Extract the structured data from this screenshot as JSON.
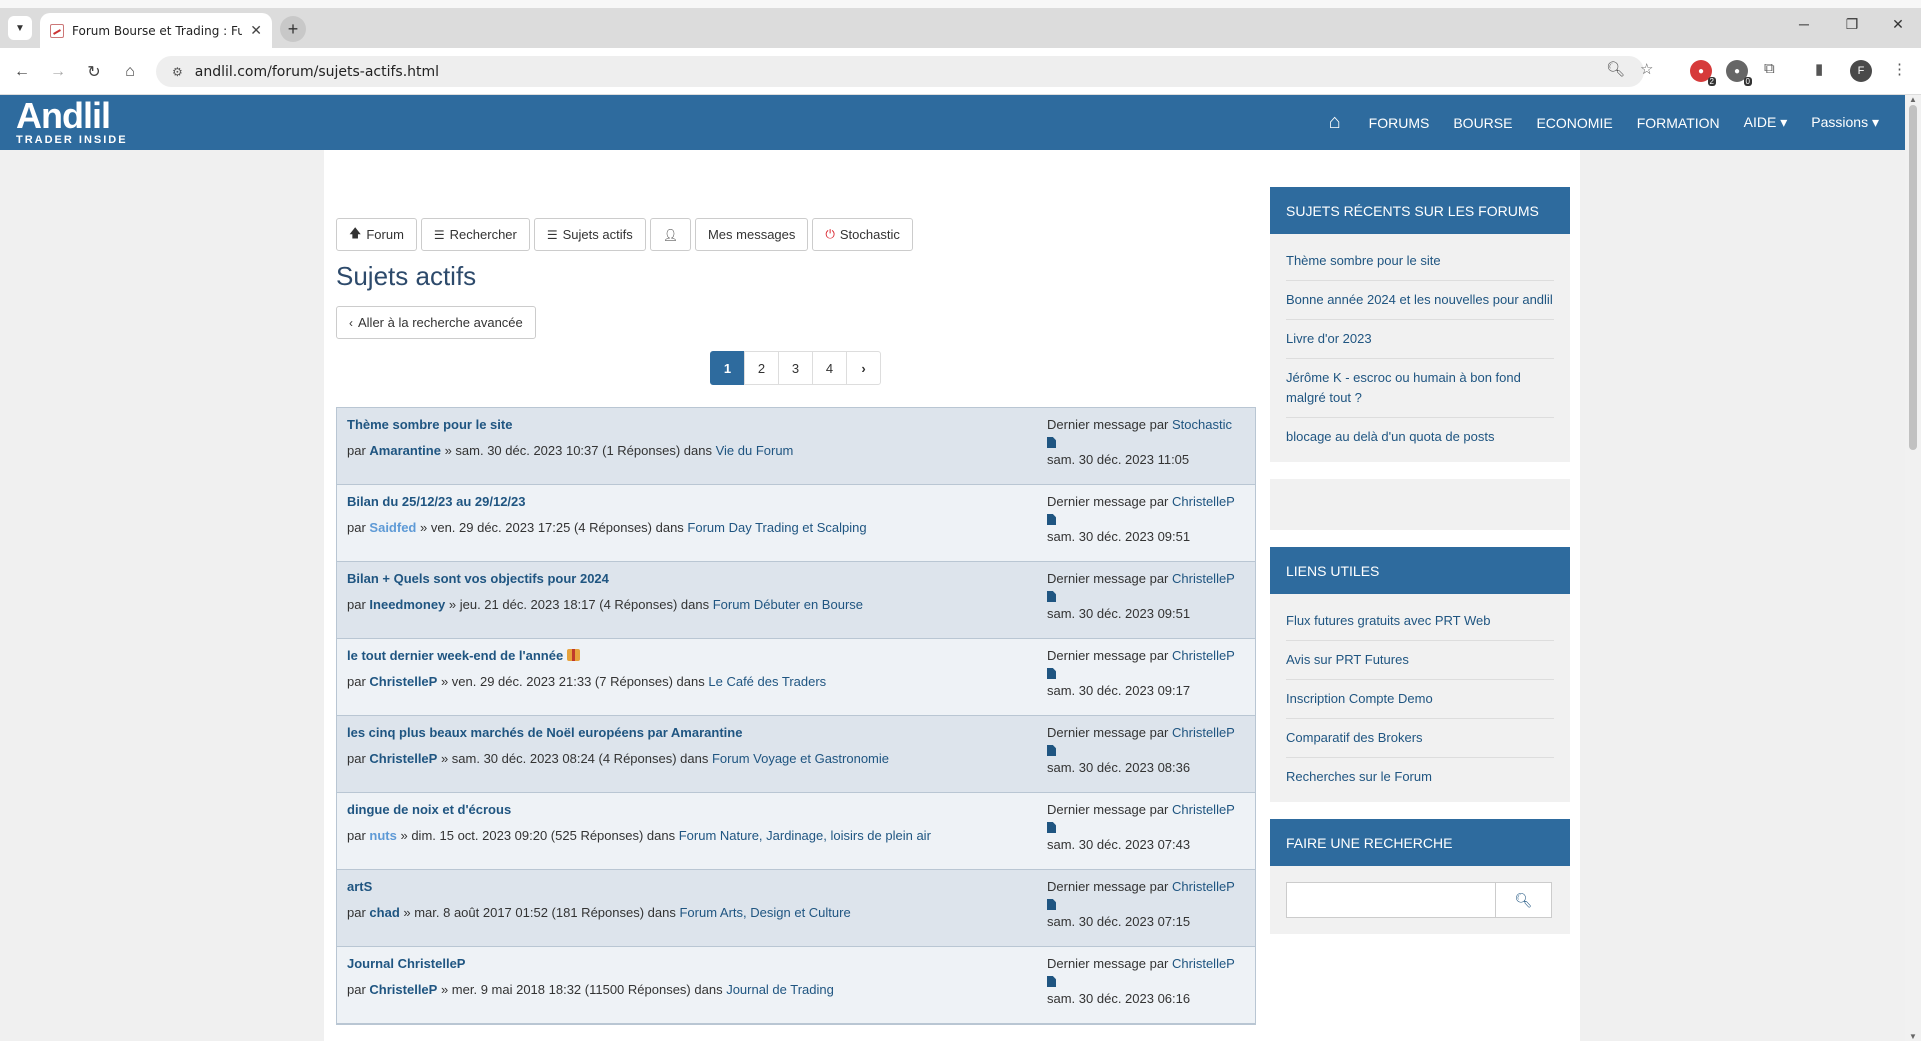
{
  "browser": {
    "tab_title": "Forum Bourse et Trading : Futures",
    "url": "andlil.com/forum/sujets-actifs.html",
    "new_tab_symbol": "+",
    "ext_badge_1": "2",
    "ext_badge_2": "0",
    "profile_initial": "F"
  },
  "site": {
    "logo_main": "Andlil",
    "logo_sub": "TRADER INSIDE",
    "nav": [
      "FORUMS",
      "BOURSE",
      "ECONOMIE",
      "FORMATION",
      "AIDE ▾",
      "Passions ▾"
    ]
  },
  "toolbar": {
    "forum": "Forum",
    "search": "Rechercher",
    "active": "Sujets actifs",
    "messages": "Mes messages",
    "logout": "Stochastic"
  },
  "page_title": "Sujets actifs",
  "advanced_search": "Aller à la recherche avancée",
  "pagination": [
    "1",
    "2",
    "3",
    "4"
  ],
  "topics": [
    {
      "title": "Thème sombre pour le site",
      "by": "par",
      "author": "Amarantine",
      "meta": " » sam. 30 déc. 2023 10:37 (1 Réponses) dans ",
      "forum": "Vie du Forum",
      "last_label": "Dernier message par ",
      "last_user": "Stochastic",
      "last_date": "sam. 30 déc. 2023 11:05"
    },
    {
      "title": "Bilan du 25/12/23 au 29/12/23",
      "by": "par",
      "author": "Saidfed",
      "meta": " » ven. 29 déc. 2023 17:25 (4 Réponses) dans ",
      "forum": "Forum Day Trading et Scalping",
      "last_label": "Dernier message par ",
      "last_user": "ChristelleP",
      "last_date": "sam. 30 déc. 2023 09:51"
    },
    {
      "title": "Bilan + Quels sont vos objectifs pour 2024",
      "by": "par",
      "author": "Ineedmoney",
      "meta": " » jeu. 21 déc. 2023 18:17 (4 Réponses) dans ",
      "forum": "Forum Débuter en Bourse",
      "last_label": "Dernier message par ",
      "last_user": "ChristelleP",
      "last_date": "sam. 30 déc. 2023 09:51"
    },
    {
      "title": "le tout dernier week-end de l'année",
      "by": "par",
      "author": "ChristelleP",
      "meta": " » ven. 29 déc. 2023 21:33 (7 Réponses) dans ",
      "forum": "Le Café des Traders",
      "last_label": "Dernier message par ",
      "last_user": "ChristelleP",
      "last_date": "sam. 30 déc. 2023 09:17"
    },
    {
      "title": "les cinq plus beaux marchés de Noël européens par Amarantine",
      "by": "par",
      "author": "ChristelleP",
      "meta": " » sam. 30 déc. 2023 08:24 (4 Réponses) dans ",
      "forum": "Forum Voyage et Gastronomie",
      "last_label": "Dernier message par ",
      "last_user": "ChristelleP",
      "last_date": "sam. 30 déc. 2023 08:36"
    },
    {
      "title": "dingue de noix et d'écrous",
      "by": "par",
      "author": "nuts",
      "meta": " » dim. 15 oct. 2023 09:20 (525 Réponses) dans ",
      "forum": "Forum Nature, Jardinage, loisirs de plein air",
      "last_label": "Dernier message par ",
      "last_user": "ChristelleP",
      "last_date": "sam. 30 déc. 2023 07:43"
    },
    {
      "title": "artS",
      "by": "par",
      "author": "chad",
      "meta": " » mar. 8 août 2017 01:52 (181 Réponses) dans ",
      "forum": "Forum Arts, Design et Culture",
      "last_label": "Dernier message par ",
      "last_user": "ChristelleP",
      "last_date": "sam. 30 déc. 2023 07:15"
    },
    {
      "title": "Journal ChristelleP",
      "by": "par",
      "author": "ChristelleP",
      "meta": " » mer. 9 mai 2018 18:32 (11500 Réponses) dans ",
      "forum": "Journal de Trading",
      "last_label": "Dernier message par ",
      "last_user": "ChristelleP",
      "last_date": "sam. 30 déc. 2023 06:16"
    }
  ],
  "sidebar": {
    "recent_title": "SUJETS RÉCENTS SUR LES FORUMS",
    "recent": [
      "Thème sombre pour le site",
      "Bonne année 2024 et les nouvelles pour andlil",
      "Livre d'or 2023",
      "Jérôme K - escroc ou humain à bon fond malgré tout ?",
      "blocage au delà d'un quota de posts"
    ],
    "links_title": "LIENS UTILES",
    "links": [
      "Flux futures gratuits avec PRT Web",
      "Avis sur PRT Futures",
      "Inscription Compte Demo",
      "Comparatif des Brokers",
      "Recherches sur le Forum"
    ],
    "search_title": "FAIRE UNE RECHERCHE"
  },
  "colors": {
    "brand": "#2e6b9e",
    "link": "#1f5581",
    "row_odd": "#dde4ec",
    "row_even": "#eef2f6"
  }
}
